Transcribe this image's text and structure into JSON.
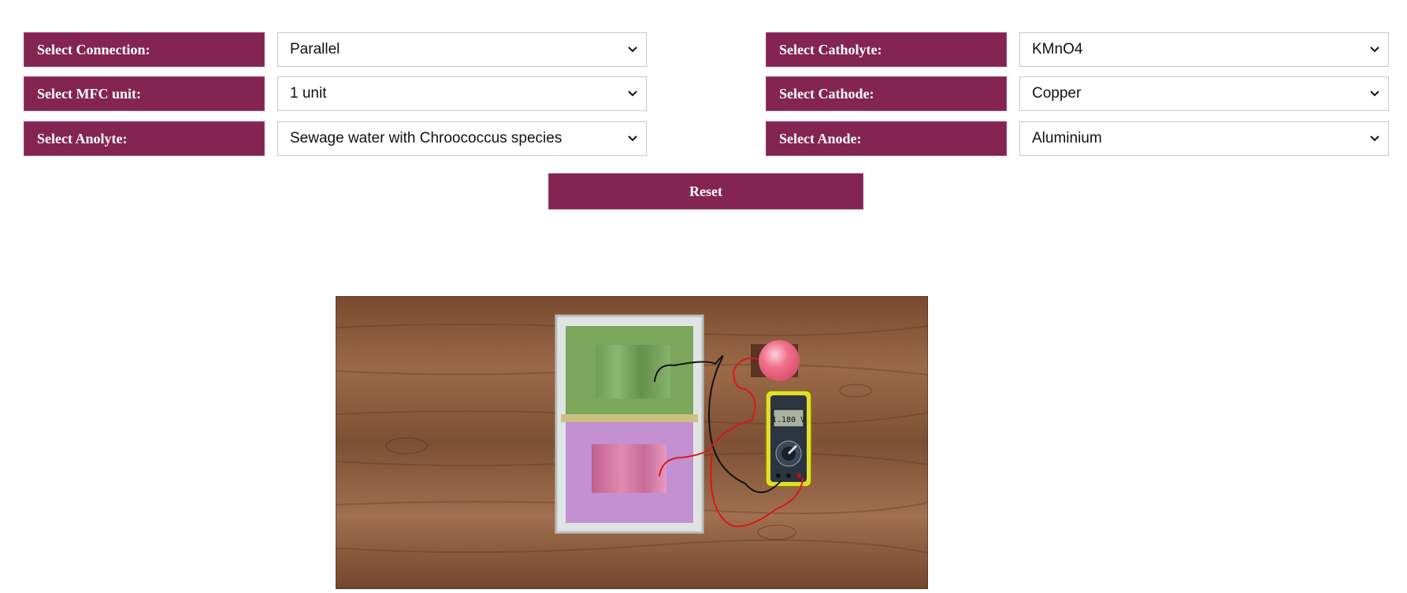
{
  "controls": {
    "connection": {
      "label": "Select Connection:",
      "value": "Parallel"
    },
    "mfc_unit": {
      "label": "Select MFC unit:",
      "value": "1 unit"
    },
    "anolyte": {
      "label": "Select Anolyte:",
      "value": "Sewage water with Chroococcus species"
    },
    "catholyte": {
      "label": "Select Catholyte:",
      "value": "KMnO4"
    },
    "cathode": {
      "label": "Select Cathode:",
      "value": "Copper"
    },
    "anode": {
      "label": "Select Anode:",
      "value": "Aluminium"
    },
    "reset_label": "Reset"
  },
  "scene": {
    "multimeter_reading": "1.180 V",
    "colors": {
      "label_bg": "#832550",
      "anolyte": "#7fa85e",
      "catholyte": "#c590d2",
      "wood": "#8a5a3c",
      "bulb": "#f0708a",
      "multimeter_body": "#e8e030"
    }
  }
}
